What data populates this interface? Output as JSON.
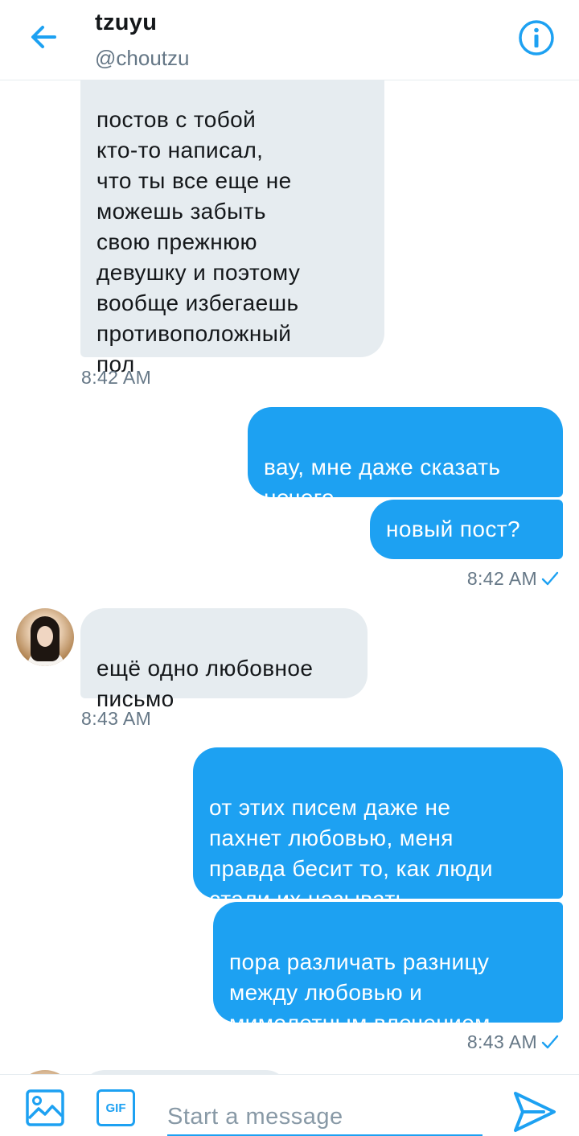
{
  "header": {
    "title": "tzuyu",
    "handle": "@choutzu"
  },
  "messages": [
    {
      "direction": "in",
      "text": "постов с тобой\nкто-то написал,\nчто ты все еще не\nможешь забыть\nсвою прежнюю\nдевушку и поэтому\nвообще избегаешь\nпротивоположный\nпол",
      "time": "8:42 AM"
    },
    {
      "direction": "out",
      "text": "вау, мне даже сказать\nнечего"
    },
    {
      "direction": "out",
      "text": "новый пост?",
      "time": "8:42 AM",
      "read": true
    },
    {
      "direction": "in",
      "text": "ещё одно любовное\nписьмо",
      "time": "8:43 AM"
    },
    {
      "direction": "out",
      "text": "от этих писем даже не\nпахнет любовью, меня\nправда бесит то, как люди\nстали их называть"
    },
    {
      "direction": "out",
      "text": "пора различать разницу\nмежду любовью и\nмимолетным влечением",
      "time": "8:43 AM",
      "read": true
    }
  ],
  "composer": {
    "placeholder": "Start a message",
    "gif_label": "GIF"
  },
  "colors": {
    "accent": "#1da1f2",
    "incoming_bubble": "#e6ecf0",
    "muted_text": "#657786"
  },
  "icons": [
    "back-arrow-icon",
    "info-icon",
    "image-icon",
    "gif-icon",
    "send-icon",
    "read-check-icon"
  ]
}
